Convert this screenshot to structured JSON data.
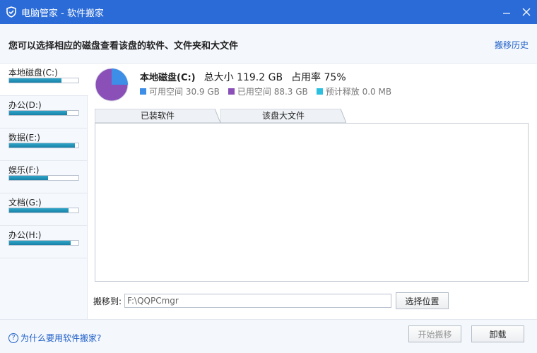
{
  "window": {
    "title": "电脑管家 - 软件搬家",
    "minimize_icon": "minimize-icon",
    "close_icon": "close-icon",
    "title_color": "#2a6bd8"
  },
  "header": {
    "instruction": "您可以选择相应的磁盘查看该盘的软件、文件夹和大文件",
    "history_link": "搬移历史"
  },
  "drives": [
    {
      "label": "本地磁盘(C:)",
      "usage": 0.75,
      "selected": true
    },
    {
      "label": "办公(D:)",
      "usage": 0.84
    },
    {
      "label": "数据(E:)",
      "usage": 0.95
    },
    {
      "label": "娱乐(F:)",
      "usage": 0.56
    },
    {
      "label": "文档(G:)",
      "usage": 0.86
    },
    {
      "label": "办公(H:)",
      "usage": 0.89
    }
  ],
  "disk": {
    "name": "本地磁盘(C:)",
    "total": "总大小 119.2 GB",
    "usage_rate": "占用率 75%",
    "available": "可用空间 30.9 GB",
    "used": "已用空间 88.3 GB",
    "release": "预计释放 0.0 MB",
    "colors": {
      "available": "#3d8ee6",
      "used": "#8a50b8",
      "release": "#2cc0e0"
    }
  },
  "tabs": [
    {
      "label": "已装软件",
      "active": true
    },
    {
      "label": "该盘大文件",
      "active": false
    }
  ],
  "move": {
    "label": "搬移到:",
    "path": "F:\\QQPCmgr",
    "choose_button": "选择位置"
  },
  "footer": {
    "help_link": "为什么要用软件搬家?",
    "start_button": "开始搬移",
    "uninstall_button": "卸载"
  }
}
